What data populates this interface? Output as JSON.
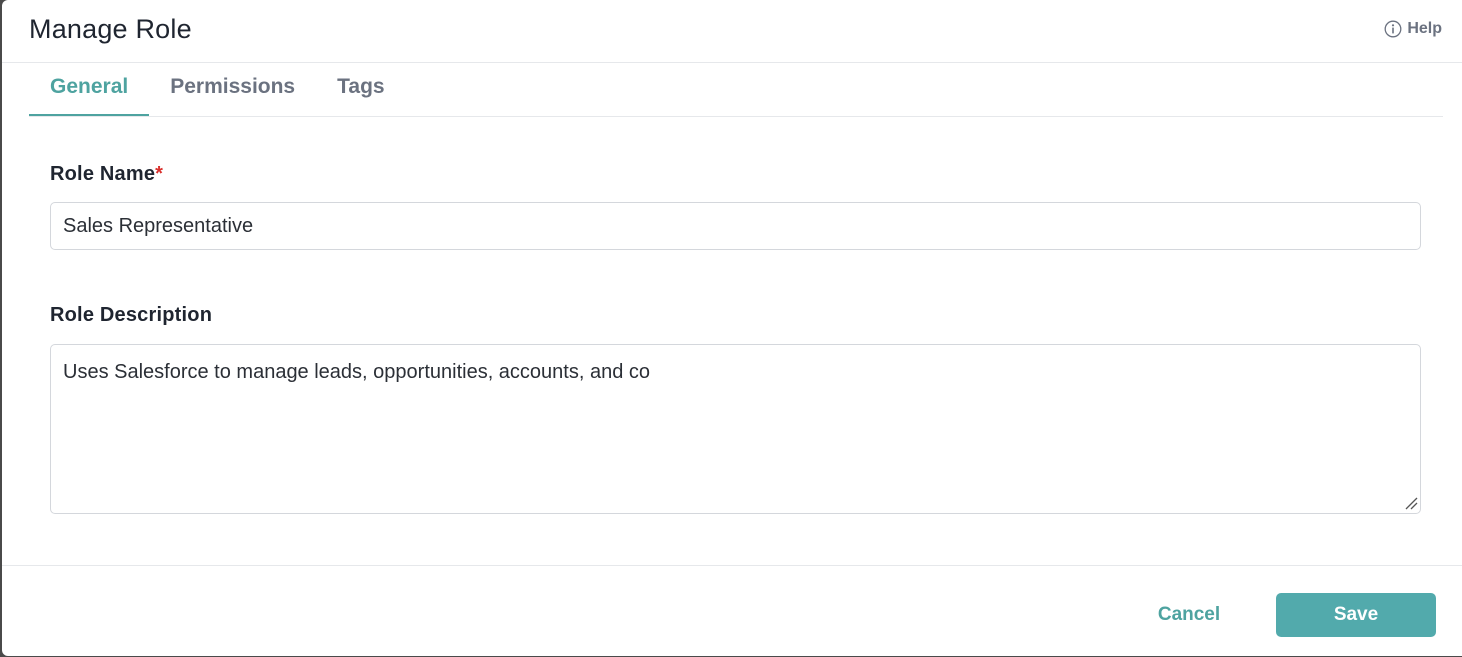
{
  "dialog": {
    "title": "Manage Role",
    "help_label": "Help",
    "help_icon": "info-circle-icon"
  },
  "tabs": [
    {
      "label": "General",
      "active": true
    },
    {
      "label": "Permissions",
      "active": false
    },
    {
      "label": "Tags",
      "active": false
    }
  ],
  "form": {
    "role_name": {
      "label": "Role Name",
      "required_marker": "*",
      "value": "Sales Representative"
    },
    "role_description": {
      "label": "Role Description",
      "value": "Uses Salesforce to manage leads, opportunities, accounts, and co"
    }
  },
  "footer": {
    "cancel_label": "Cancel",
    "save_label": "Save"
  },
  "colors": {
    "accent": "#4ea3a0",
    "save_button": "#52aaac",
    "required": "#d9302c",
    "text": "#1f2530",
    "muted": "#6b7280"
  }
}
